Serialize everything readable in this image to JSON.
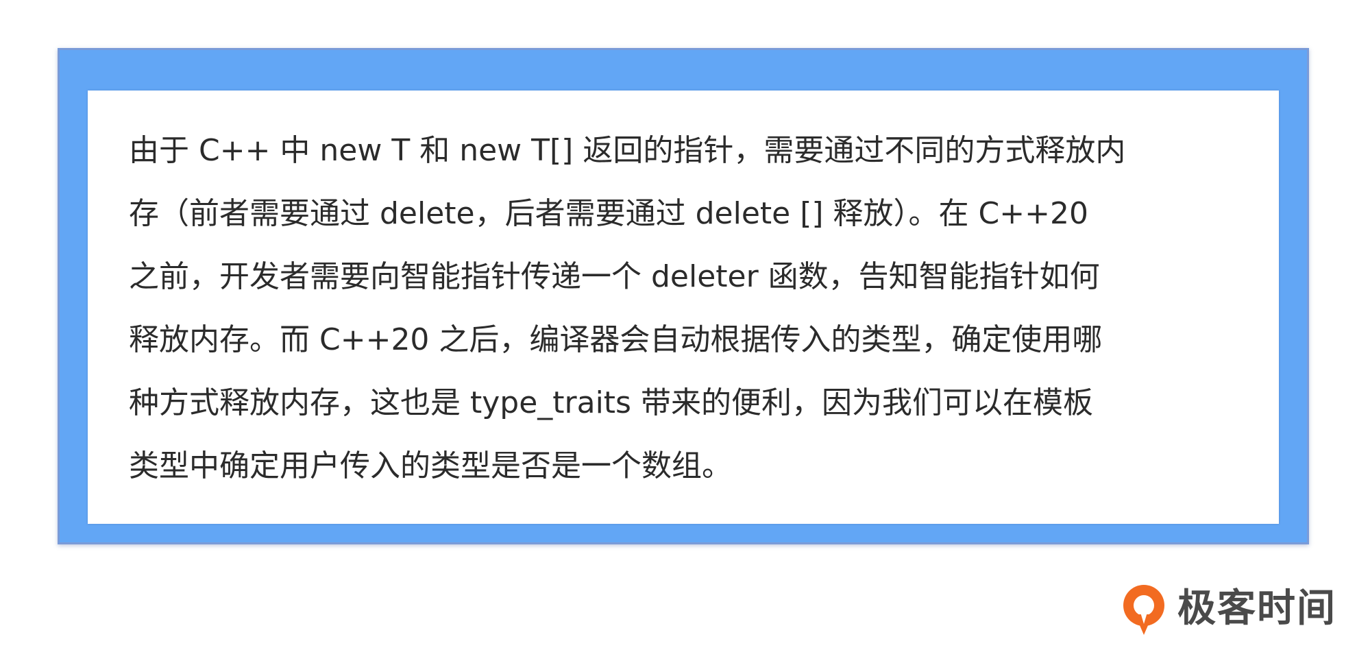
{
  "content": {
    "lines": [
      "由于 C++ 中 new T 和 new T[] 返回的指针，需要通过不同的方式释放内",
      "存（前者需要通过 delete，后者需要通过 delete [] 释放）。在 C++20",
      "之前，开发者需要向智能指针传递一个 deleter 函数，告知智能指针如何",
      "释放内存。而 C++20 之后，编译器会自动根据传入的类型，确定使用哪",
      "种方式释放内存，这也是 type_traits 带来的便利，因为我们可以在模板",
      "类型中确定用户传入的类型是否是一个数组。"
    ]
  },
  "brand": {
    "name": "极客时间",
    "icon": "geektime-logo-icon",
    "accent": "#f26b21"
  },
  "colors": {
    "frame": "#62a6f5",
    "frame_border": "#7a9bd8",
    "text": "#2b2b2b"
  }
}
